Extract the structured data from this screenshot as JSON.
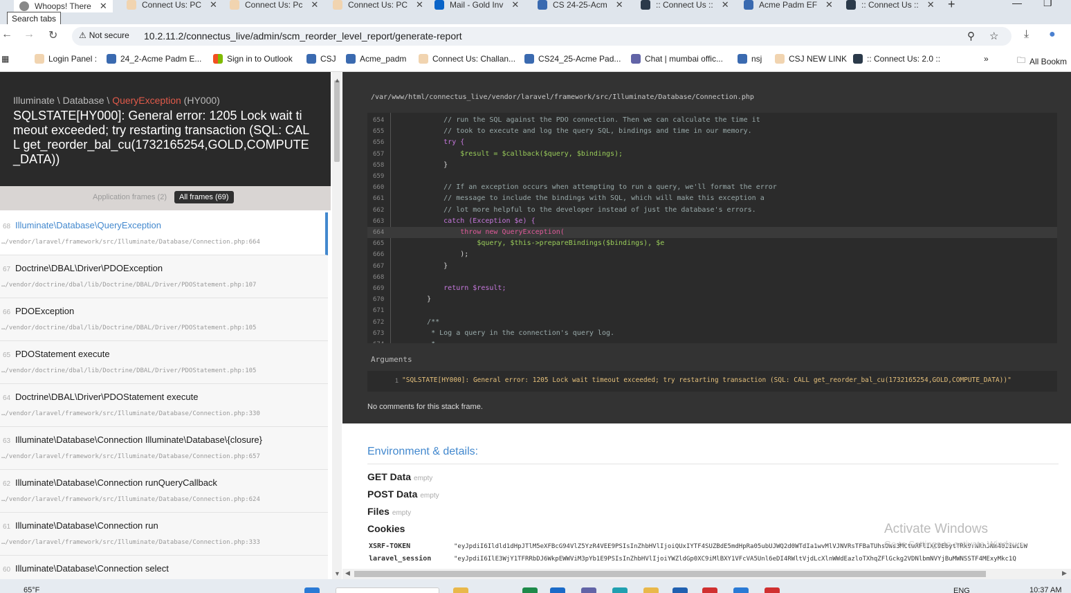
{
  "browser": {
    "tabs": [
      {
        "title": "Whoops! There",
        "active": true
      },
      {
        "title": "Connect Us: PC"
      },
      {
        "title": "Connect Us: Pc"
      },
      {
        "title": "Connect Us: PC"
      },
      {
        "title": "Mail - Gold Inv"
      },
      {
        "title": "CS 24-25-Acm"
      },
      {
        "title": ":: Connect Us ::"
      },
      {
        "title": "Acme Padm EF"
      },
      {
        "title": ":: Connect Us ::"
      }
    ],
    "tooltip": "Search tabs",
    "security_label": "Not secure",
    "url": "10.2.11.2/connectus_live/admin/scm_reorder_level_report/generate-report",
    "bookmarks": [
      "Login Panel :",
      "24_2-Acme Padm E...",
      "Sign in to Outlook",
      "CSJ",
      "Acme_padm",
      "Connect Us: Challan...",
      "CS24_25-Acme Pad...",
      "Chat | mumbai offic...",
      "nsj",
      "CSJ NEW LINK",
      ":: Connect Us: 2.0 ::"
    ],
    "all_bookmarks": "All Bookm"
  },
  "exception": {
    "path_prefix": "Illuminate \\ Database \\ ",
    "class_name": "QueryException",
    "code": " (HY000)",
    "message": "SQLSTATE[HY000]: General error: 1205 Lock wait timeout exceeded; try restarting transaction (SQL: CALL get_reorder_bal_cu(1732165254,GOLD,COMPUTE_DATA))"
  },
  "filters": {
    "app_frames": "Application frames (2)",
    "all_frames": "All frames (69)"
  },
  "frames": [
    {
      "num": "68",
      "cls": "Illuminate\\Database\\QueryException",
      "file": "…/vendor/laravel/framework/src/Illuminate/Database/Connection.php:664"
    },
    {
      "num": "67",
      "cls": "Doctrine\\DBAL\\Driver\\PDOException",
      "file": "…/vendor/doctrine/dbal/lib/Doctrine/DBAL/Driver/PDOStatement.php:107"
    },
    {
      "num": "66",
      "cls": "PDOException",
      "file": "…/vendor/doctrine/dbal/lib/Doctrine/DBAL/Driver/PDOStatement.php:105"
    },
    {
      "num": "65",
      "cls": "PDOStatement execute",
      "file": "…/vendor/doctrine/dbal/lib/Doctrine/DBAL/Driver/PDOStatement.php:105"
    },
    {
      "num": "64",
      "cls": "Doctrine\\DBAL\\Driver\\PDOStatement execute",
      "file": "…/vendor/laravel/framework/src/Illuminate/Database/Connection.php:330"
    },
    {
      "num": "63",
      "cls": "Illuminate\\Database\\Connection Illuminate\\Database\\{closure}",
      "file": "…/vendor/laravel/framework/src/Illuminate/Database/Connection.php:657"
    },
    {
      "num": "62",
      "cls": "Illuminate\\Database\\Connection runQueryCallback",
      "file": "…/vendor/laravel/framework/src/Illuminate/Database/Connection.php:624"
    },
    {
      "num": "61",
      "cls": "Illuminate\\Database\\Connection run",
      "file": "…/vendor/laravel/framework/src/Illuminate/Database/Connection.php:333"
    },
    {
      "num": "60",
      "cls": "Illuminate\\Database\\Connection select",
      "file": ""
    }
  ],
  "source": {
    "file_path": "/var/www/html/connectus_live/vendor/laravel/framework/src/Illuminate/Database/Connection.php",
    "lines": [
      {
        "n": "654",
        "text": "        // run the SQL against the PDO connection. Then we can calculate the time it",
        "kind": "cm"
      },
      {
        "n": "655",
        "text": "        // took to execute and log the query SQL, bindings and time in our memory.",
        "kind": "cm"
      },
      {
        "n": "656",
        "text": "        try {",
        "kind": "kw"
      },
      {
        "n": "657",
        "text": "            $result = $callback($query, $bindings);",
        "kind": "var"
      },
      {
        "n": "658",
        "text": "        }",
        "kind": "pl"
      },
      {
        "n": "659",
        "text": "",
        "kind": "pl"
      },
      {
        "n": "660",
        "text": "        // If an exception occurs when attempting to run a query, we'll format the error",
        "kind": "cm"
      },
      {
        "n": "661",
        "text": "        // message to include the bindings with SQL, which will make this exception a",
        "kind": "cm"
      },
      {
        "n": "662",
        "text": "        // lot more helpful to the developer instead of just the database's errors.",
        "kind": "cm"
      },
      {
        "n": "663",
        "text": "        catch (Exception $e) {",
        "kind": "kw"
      },
      {
        "n": "664",
        "text": "            throw new QueryException(",
        "kind": "fn",
        "highlight": true
      },
      {
        "n": "665",
        "text": "                $query, $this->prepareBindings($bindings), $e",
        "kind": "var"
      },
      {
        "n": "666",
        "text": "            );",
        "kind": "pl"
      },
      {
        "n": "667",
        "text": "        }",
        "kind": "pl"
      },
      {
        "n": "668",
        "text": "",
        "kind": "pl"
      },
      {
        "n": "669",
        "text": "        return $result;",
        "kind": "kw"
      },
      {
        "n": "670",
        "text": "    }",
        "kind": "pl"
      },
      {
        "n": "671",
        "text": "",
        "kind": "pl"
      },
      {
        "n": "672",
        "text": "    /**",
        "kind": "cm"
      },
      {
        "n": "673",
        "text": "     * Log a query in the connection's query log.",
        "kind": "cm"
      },
      {
        "n": "674",
        "text": "     *",
        "kind": "cm"
      }
    ]
  },
  "arguments": {
    "heading": "Arguments",
    "index": "1",
    "value": "\"SQLSTATE[HY000]: General error: 1205 Lock wait timeout exceeded; try restarting transaction (SQL: CALL get_reorder_bal_cu(1732165254,GOLD,COMPUTE_DATA))\""
  },
  "no_comments": "No comments for this stack frame.",
  "env": {
    "heading": "Environment & details:",
    "get": "GET Data",
    "post": "POST Data",
    "files": "Files",
    "empty": "empty",
    "cookies": "Cookies",
    "cookie_rows": [
      {
        "key": "XSRF-TOKEN",
        "value": "\"eyJpdiI6Ildld1dHpJTlM5eXFBcG94VlZ5YzR4VEE9PSIsInZhbHVlIjoiQUxIYTF4SUZBdE5mdHpRa05ubUJWQ2d0WTdIa1wvMlVJNVRsTFBaTUhsOWs3MCtwRFlIXC9EbytTRk9rNkhJNm40IiwibW"
      },
      {
        "key": "laravel_session",
        "value": "\"eyJpdiI6IlE3WjY1TFRRbDJ6WkpEWWViM3pYb1E9PSIsInZhbHVlIjoiYWZldGp0XC9iMlBXY1VFcVA5Unl6eDI4RWltVjdLcXlnWWdEazloTXhqZFlGckg2VDNlbmNVYjBuMWNSSTF4MExyMkc1Q"
      }
    ]
  },
  "watermark": {
    "line1": "Activate Windows",
    "line2": "Go to Settings to activate Windows."
  },
  "taskbar": {
    "weather": "65°F",
    "lang": "ENG",
    "time": "10:37 AM"
  },
  "colors": {
    "accent": "#4288ce",
    "exception_class": "#e05a4a",
    "dark_bg": "#333333"
  }
}
